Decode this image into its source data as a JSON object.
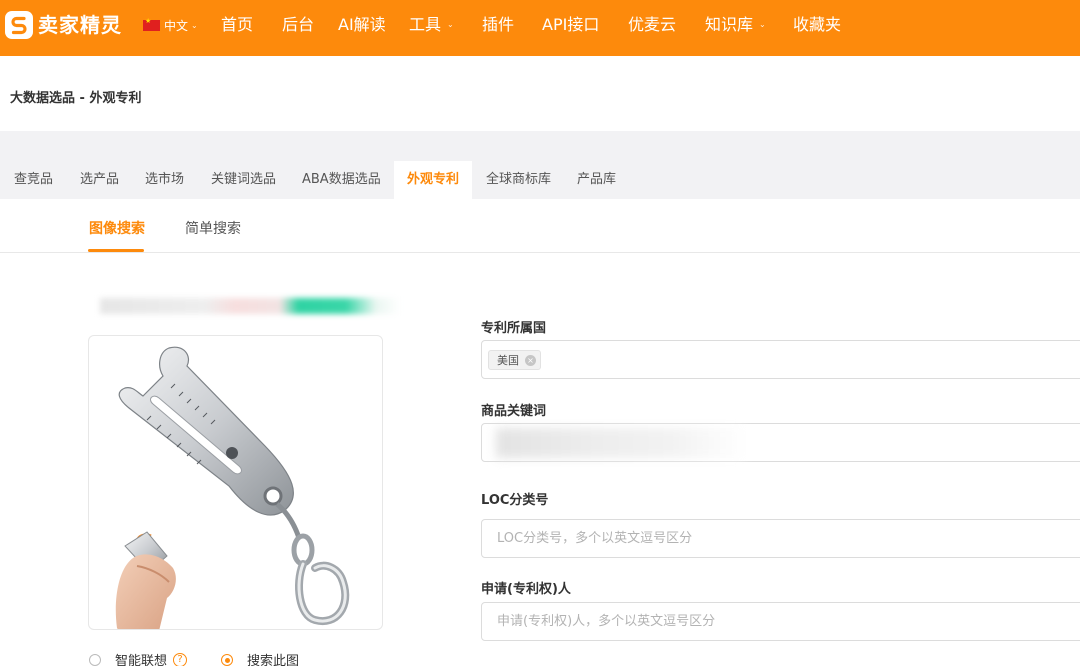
{
  "brand": {
    "name": "卖家精灵",
    "color": "#fd8a0c"
  },
  "language": {
    "label": "中文",
    "flag": "cn-flag-icon"
  },
  "nav": {
    "items": [
      {
        "label": "首页",
        "dropdown": false
      },
      {
        "label": "后台",
        "dropdown": false
      },
      {
        "label": "AI解读",
        "dropdown": false
      },
      {
        "label": "工具",
        "dropdown": true
      },
      {
        "label": "插件",
        "dropdown": false
      },
      {
        "label": "API接口",
        "dropdown": false
      },
      {
        "label": "优麦云",
        "dropdown": false
      },
      {
        "label": "知识库",
        "dropdown": true
      },
      {
        "label": "收藏夹",
        "dropdown": false
      }
    ]
  },
  "breadcrumb": {
    "text": "大数据选品 - 外观专利"
  },
  "tabs": [
    {
      "label": "查竞品",
      "active": false
    },
    {
      "label": "选产品",
      "active": false
    },
    {
      "label": "选市场",
      "active": false
    },
    {
      "label": "关键词选品",
      "active": false
    },
    {
      "label": "ABA数据选品",
      "active": false
    },
    {
      "label": "外观专利",
      "active": true
    },
    {
      "label": "全球商标库",
      "active": false
    },
    {
      "label": "产品库",
      "active": false
    }
  ],
  "subtabs": [
    {
      "label": "图像搜索",
      "active": true
    },
    {
      "label": "简单搜索",
      "active": false
    }
  ],
  "search_options": {
    "smart_label": "智能联想",
    "smart_checked": false,
    "this_image_label": "搜索此图",
    "this_image_checked": true
  },
  "form": {
    "country": {
      "label": "专利所属国",
      "selected": [
        "美国"
      ]
    },
    "keyword": {
      "label": "商品关键词",
      "value": ""
    },
    "loc": {
      "label": "LOC分类号",
      "placeholder": "LOC分类号，多个以英文逗号区分"
    },
    "applicant": {
      "label": "申请(专利权)人",
      "placeholder": "申请(专利权)人，多个以英文逗号区分"
    }
  }
}
